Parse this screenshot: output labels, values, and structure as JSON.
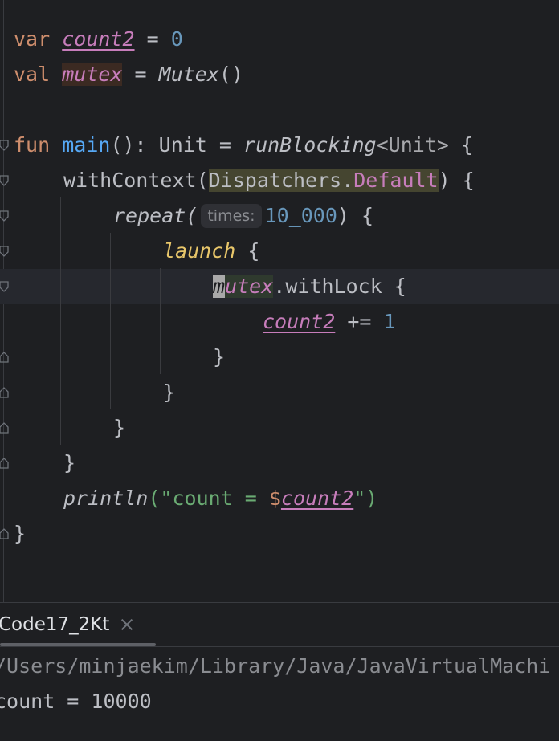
{
  "editor": {
    "lines": [
      {
        "id": "l1",
        "parts": [
          "var",
          "count2",
          " = ",
          "0"
        ]
      },
      {
        "id": "l2",
        "parts": [
          "val",
          "mutex",
          " = ",
          "Mutex",
          "()"
        ]
      },
      {
        "id": "l4",
        "parts": [
          "fun",
          "main",
          "(): ",
          "Unit",
          " = ",
          "runBlocking",
          "<Unit>",
          " {"
        ]
      },
      {
        "id": "l5",
        "parts": [
          "withContext(",
          "Dispatchers.",
          "Default",
          ") {"
        ]
      },
      {
        "id": "l6",
        "parts": [
          "repeat(",
          "times:",
          "10_000",
          ") {"
        ]
      },
      {
        "id": "l7",
        "parts": [
          "launch",
          " {"
        ]
      },
      {
        "id": "l8",
        "parts": [
          "m",
          "utex",
          ".withLock {"
        ]
      },
      {
        "id": "l9",
        "parts": [
          "count2",
          " += ",
          "1"
        ]
      },
      {
        "id": "l10",
        "parts": [
          "}"
        ]
      },
      {
        "id": "l11",
        "parts": [
          "}"
        ]
      },
      {
        "id": "l12",
        "parts": [
          "}"
        ]
      },
      {
        "id": "l13",
        "parts": [
          "}"
        ]
      },
      {
        "id": "l14",
        "parts": [
          "println",
          "(\"count = ",
          "$",
          "count2",
          "\")"
        ]
      },
      {
        "id": "l15",
        "parts": [
          "}"
        ]
      }
    ]
  },
  "run_panel": {
    "tab_label": "Code17_2Kt",
    "path_line": "/Users/minjaekim/Library/Java/JavaVirtualMachi",
    "output_line": "count = 10000"
  },
  "colors": {
    "background": "#1e1f22",
    "keyword": "#cf8e6d",
    "property": "#c77dbb",
    "number": "#6897bb",
    "string": "#6aab73",
    "function_decl": "#56a8f5",
    "text": "#bcbec4"
  }
}
